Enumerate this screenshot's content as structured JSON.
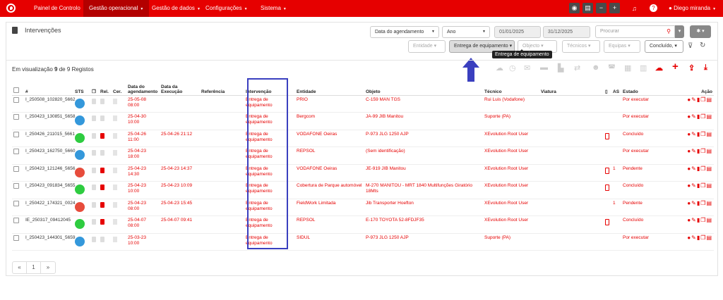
{
  "nav": {
    "items": [
      {
        "label": "Painel de Controlo"
      },
      {
        "label": "Gestão operacional"
      },
      {
        "label": "Gestão de dados"
      },
      {
        "label": "Configurações"
      },
      {
        "label": "Sistema"
      }
    ],
    "user": "Diego miranda"
  },
  "page": {
    "title": "Intervenções"
  },
  "filters": {
    "date_type": "Data do agendamento",
    "period": "Ano",
    "date_from": "01/01/2025",
    "date_to": "31/12/2025",
    "search_placeholder": "Procurar",
    "entidade": "Entidade",
    "intervention_type": "Entrega de equipamento",
    "objecto": "Objecto",
    "tecnicos": "Técnicos",
    "equipas": "Equipas",
    "estado": "Concluído,",
    "tooltip": "Entrega de equipamento"
  },
  "summary": {
    "prefix": "Em visualização",
    "count": "9",
    "middle": "de",
    "total": "9",
    "suffix": "Registos"
  },
  "table": {
    "headers": {
      "num": "#",
      "sts": "STS",
      "rel": "Rel.",
      "cer": "Cer.",
      "agendamento": "Data do agendamento",
      "execucao": "Data da Execução",
      "referencia": "Referência",
      "intervencao": "Intervenção",
      "entidade": "Entidade",
      "objeto": "Objeto",
      "tecnico": "Técnico",
      "viatura": "Viatura",
      "as": "AS",
      "estado": "Estado",
      "acao": "Ação"
    },
    "rows": [
      {
        "id": "I_250508_102820_5662",
        "sts": "#3498db",
        "rel_red": false,
        "agend": "25-05-08 08:00",
        "exec": "",
        "interv": "Entrega de equipamento",
        "entidade": "PRIO",
        "objeto": "C-159 MAN TGS",
        "tecnico": "Rui Luis (Vodafone)",
        "mobile": false,
        "as": "",
        "estado": "Por executar"
      },
      {
        "id": "I_250423_130851_5658",
        "sts": "#3498db",
        "rel_red": false,
        "agend": "25-04-30 10:00",
        "exec": "",
        "interv": "Entrega de equipamento",
        "entidade": "Bergcom",
        "objeto": "JA-99 JIB Manitou",
        "tecnico": "Suporte (PA)",
        "mobile": false,
        "as": "",
        "estado": "Por executar"
      },
      {
        "id": "I_250426_211015_5661",
        "sts": "#2ecc40",
        "rel_red": true,
        "agend": "25-04-26 11:00",
        "exec": "25-04-26 21:12",
        "interv": "Entrega de equipamento",
        "entidade": "VODAFONE Oeiras",
        "objeto": "P-973 JLG 1250 AJP",
        "tecnico": "XEvolution Root User",
        "mobile": true,
        "as": "",
        "estado": "Concluído"
      },
      {
        "id": "I_250423_162750_5660",
        "sts": "#3498db",
        "rel_red": false,
        "agend": "25-04-23 18:00",
        "exec": "",
        "interv": "Entrega de equipamento",
        "entidade": "REPSOL",
        "objeto": "(Sem identificação)",
        "tecnico": "XEvolution Root User",
        "mobile": false,
        "as": "",
        "estado": "Por executar"
      },
      {
        "id": "I_250423_121246_5656",
        "sts": "#e74c3c",
        "rel_red": true,
        "agend": "25-04-23 14:30",
        "exec": "25-04-23 14:37",
        "interv": "Entrega de equipamento",
        "entidade": "VODAFONE Oeiras",
        "objeto": "JE-919 JIB Manitou",
        "tecnico": "XEvolution Root User",
        "mobile": true,
        "as": "1",
        "estado": "Pendente"
      },
      {
        "id": "I_250423_091834_5655",
        "sts": "#2ecc40",
        "rel_red": true,
        "agend": "25-04-23 10:00",
        "exec": "25-04-23 10:09",
        "interv": "Entrega de equipamento",
        "entidade": "Cobertura de Parque automóvel",
        "objeto": "M-270 MANITOU - MRT 1840 Multifunções Giratório 18Mts",
        "tecnico": "XEvolution Root User",
        "mobile": true,
        "as": "",
        "estado": "Concluído"
      },
      {
        "id": "I_250422_174321_0024",
        "sts": "#e74c3c",
        "rel_red": true,
        "agend": "25-04-23 08:00",
        "exec": "25-04-23 15:45",
        "interv": "Entrega de equipamento",
        "entidade": "FieldWork Limitada",
        "objeto": "Jib Transporter Hoefton",
        "tecnico": "XEvolution Root User",
        "mobile": false,
        "as": "1",
        "estado": "Pendente"
      },
      {
        "id": "IE_250317_09412045",
        "sts": "#2ecc40",
        "rel_red": true,
        "agend": "25-04-07 08:00",
        "exec": "25-04-07 09:41",
        "interv": "Entrega de equipamento",
        "entidade": "REPSOL",
        "objeto": "E-170 TOYOTA 52-8FDJF35",
        "tecnico": "XEvolution Root User",
        "mobile": true,
        "as": "",
        "estado": "Concluído"
      },
      {
        "id": "I_250423_144301_5659",
        "sts": "#3498db",
        "rel_red": false,
        "agend": "25-03-23 10:00",
        "exec": "",
        "interv": "Entrega de equipamento",
        "entidade": "SIDUL",
        "objeto": "P-973 JLG 1250 AJP",
        "tecnico": "Suporte (PA)",
        "mobile": false,
        "as": "",
        "estado": "Por executar"
      }
    ]
  },
  "pagination": {
    "prev": "«",
    "page": "1",
    "next": "»"
  },
  "colors": {
    "brand": "#e60000",
    "highlight": "#3a3fbf"
  }
}
